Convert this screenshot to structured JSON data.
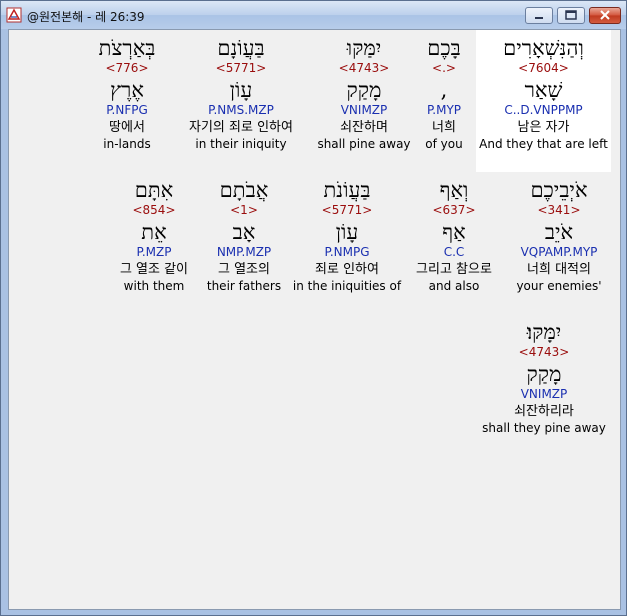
{
  "window": {
    "title": "@원전본해 - 레 26:39",
    "minimize_label": "minimize",
    "maximize_label": "maximize",
    "close_label": "close"
  },
  "rows": [
    [
      {
        "hebrew": "וְהַנִּשְׁאָרִים",
        "strong": "<7604>",
        "lemma": "שָׁאַר",
        "parse": "C..D.VNPPMP",
        "korean": "남은 자가",
        "english": "And they that are left",
        "highlight": true
      },
      {
        "hebrew": "בָּכֶם",
        "strong": "<.>",
        "lemma": ",",
        "parse": "P.MYP",
        "korean": "너희",
        "english": "of you",
        "highlight": false
      },
      {
        "hebrew": "יִמַּקּוּ",
        "strong": "<4743>",
        "lemma": "מָקַק",
        "parse": "VNIMZP",
        "korean": "쇠잔하며",
        "english": "shall pine away",
        "highlight": false
      },
      {
        "hebrew": "בַּעֲוֹנָם",
        "strong": "<5771>",
        "lemma": "עָוֹן",
        "parse": "P.NMS.MZP",
        "korean": "자기의 죄로 인하여",
        "english": "in their iniquity",
        "highlight": false
      },
      {
        "hebrew": "בְּאַרְצֹת",
        "strong": "<776>",
        "lemma": "אֶרֶץ",
        "parse": "P.NFPG",
        "korean": "땅에서",
        "english": "in-lands",
        "highlight": false
      }
    ],
    [
      {
        "hebrew": "אֹיְבֵיכֶם",
        "strong": "<341>",
        "lemma": "אֹיֵב",
        "parse": "VQPAMP.MYP",
        "korean": "너희 대적의",
        "english": "your enemies'",
        "highlight": false
      },
      {
        "hebrew": "וְאַף",
        "strong": "<637>",
        "lemma": "אַף",
        "parse": "C.C",
        "korean": "그리고 참으로",
        "english": "and also",
        "highlight": false
      },
      {
        "hebrew": "בַּעֲוֹנֹת",
        "strong": "<5771>",
        "lemma": "עָוֹן",
        "parse": "P.NMPG",
        "korean": "죄로 인하여",
        "english": "in the iniquities of",
        "highlight": false
      },
      {
        "hebrew": "אֲבֹתָם",
        "strong": "<1>",
        "lemma": "אָב",
        "parse": "NMP.MZP",
        "korean": "그 열조의",
        "english": "their fathers",
        "highlight": false
      },
      {
        "hebrew": "אִתָּם",
        "strong": "<854>",
        "lemma": "אֵת",
        "parse": "P.MZP",
        "korean": "그 열조 같이",
        "english": "with them",
        "highlight": false
      }
    ],
    [
      {
        "hebrew": "יִמָּקּוּ׃",
        "strong": "<4743>",
        "lemma": "מָקַק",
        "parse": "VNIMZP",
        "korean": "쇠잔하리라",
        "english": "shall they pine away",
        "highlight": false
      }
    ]
  ]
}
